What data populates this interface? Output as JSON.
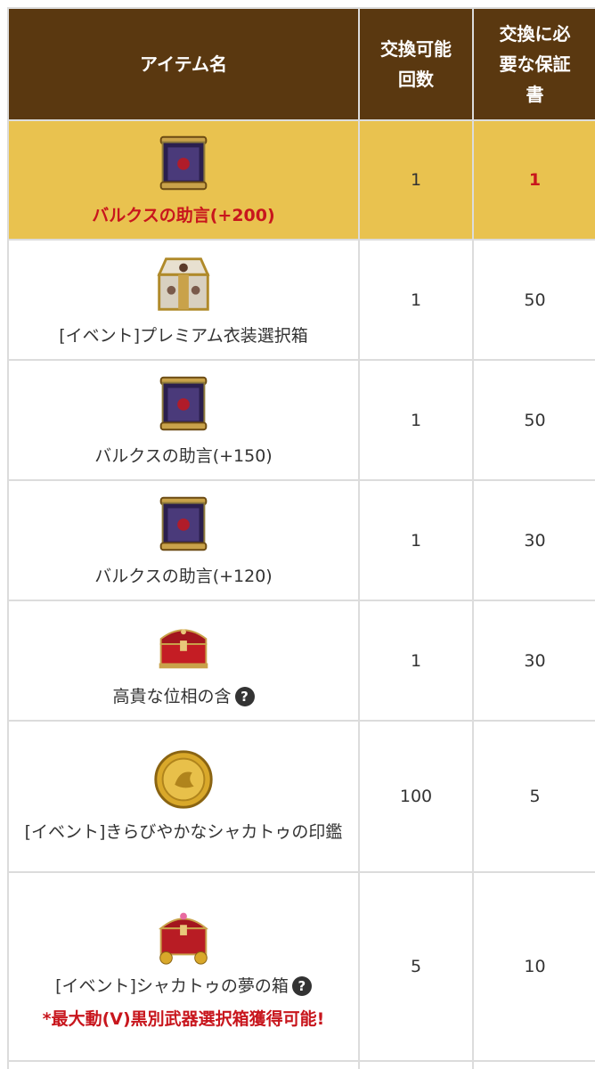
{
  "table": {
    "headers": [
      "アイテム名",
      "交換可能回数",
      "交換に必要な保証書"
    ],
    "rows": [
      {
        "name": "バルクスの助言(+200)",
        "count": "1",
        "required": "1",
        "icon": "scroll-icon",
        "highlight": true
      },
      {
        "name": "[イベント]プレミアム衣装選択箱",
        "count": "1",
        "required": "50",
        "icon": "premium-chest-icon"
      },
      {
        "name": "バルクスの助言(+150)",
        "count": "1",
        "required": "50",
        "icon": "scroll-icon"
      },
      {
        "name": "バルクスの助言(+120)",
        "count": "1",
        "required": "30",
        "icon": "scroll-icon"
      },
      {
        "name": "高貴な位相の含",
        "count": "1",
        "required": "30",
        "icon": "red-box-icon",
        "help": "?"
      },
      {
        "name": "[イベント]きらびやかなシャカトゥの印鑑",
        "count": "100",
        "required": "5",
        "icon": "gold-coin-icon"
      },
      {
        "name": "[イベント]シャカトゥの夢の箱",
        "count": "5",
        "required": "10",
        "icon": "treasure-chest-icon",
        "help": "?",
        "note": "*最大動(V)黒別武器選択箱獲得可能!"
      }
    ]
  },
  "colors": {
    "header_bg": "#5a3810",
    "highlight_bg": "#e9c24f",
    "accent_red": "#c8161d"
  }
}
